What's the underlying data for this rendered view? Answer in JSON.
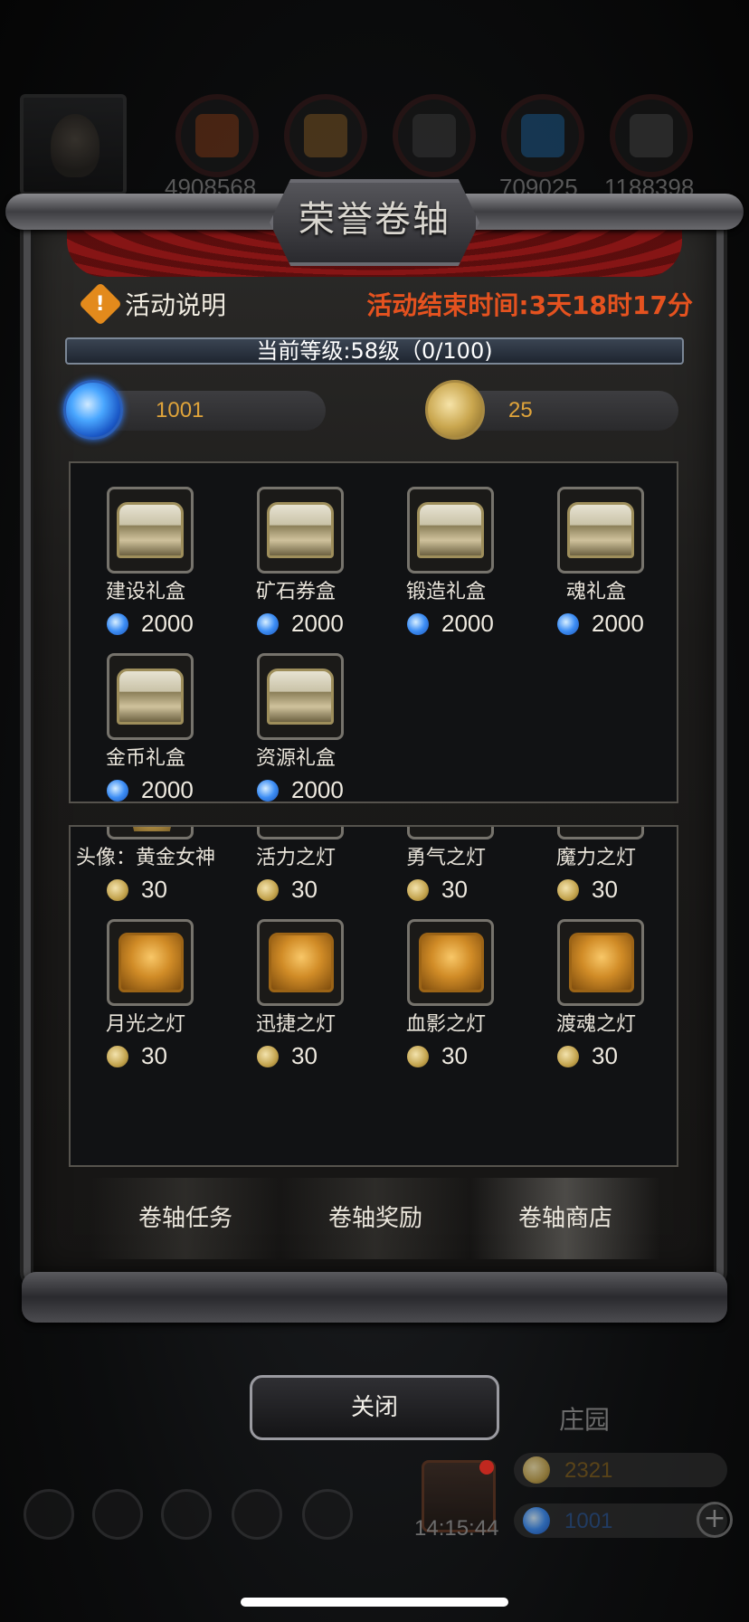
{
  "hud": {
    "resources": [
      "4908568",
      "",
      "",
      "709025",
      "1188398"
    ],
    "time": "14:15:44",
    "manor_label": "庄园",
    "gold": "2321",
    "gems": "1001"
  },
  "panel": {
    "title": "荣誉卷轴",
    "info_label": "活动说明",
    "timer": "活动结束时间:3天18时17分",
    "level": "当前等级:58级（0/100)",
    "gem_balance": "1001",
    "coin_balance": "25"
  },
  "gem_shop": [
    {
      "name": "建设礼盒",
      "price": "2000",
      "icon": "chest-icon"
    },
    {
      "name": "矿石券盒",
      "price": "2000",
      "icon": "chest-icon"
    },
    {
      "name": "锻造礼盒",
      "price": "2000",
      "icon": "chest-icon"
    },
    {
      "name": "魂礼盒",
      "price": "2000",
      "icon": "chest-icon"
    },
    {
      "name": "金币礼盒",
      "price": "2000",
      "icon": "chest-icon"
    },
    {
      "name": "资源礼盒",
      "price": "2000",
      "icon": "chest-icon"
    }
  ],
  "coin_shop": [
    {
      "name": "头像：黄金女神",
      "price": "30",
      "icon": "goddess-portrait-icon"
    },
    {
      "name": "活力之灯",
      "price": "30",
      "icon": "lamp-icon"
    },
    {
      "name": "勇气之灯",
      "price": "30",
      "icon": "lamp-icon"
    },
    {
      "name": "魔力之灯",
      "price": "30",
      "icon": "lamp-icon"
    },
    {
      "name": "月光之灯",
      "price": "30",
      "icon": "lamp-icon"
    },
    {
      "name": "迅捷之灯",
      "price": "30",
      "icon": "lamp-icon"
    },
    {
      "name": "血影之灯",
      "price": "30",
      "icon": "lamp-icon"
    },
    {
      "name": "渡魂之灯",
      "price": "30",
      "icon": "lamp-icon"
    }
  ],
  "tabs": [
    {
      "label": "卷轴任务"
    },
    {
      "label": "卷轴奖励"
    },
    {
      "label": "卷轴商店",
      "active": true
    }
  ],
  "close_label": "关闭",
  "colors": {
    "timer": "#e5521f",
    "balance": "#e0a43a",
    "gem": "#3d8ef5",
    "coin": "#c2a24c"
  }
}
